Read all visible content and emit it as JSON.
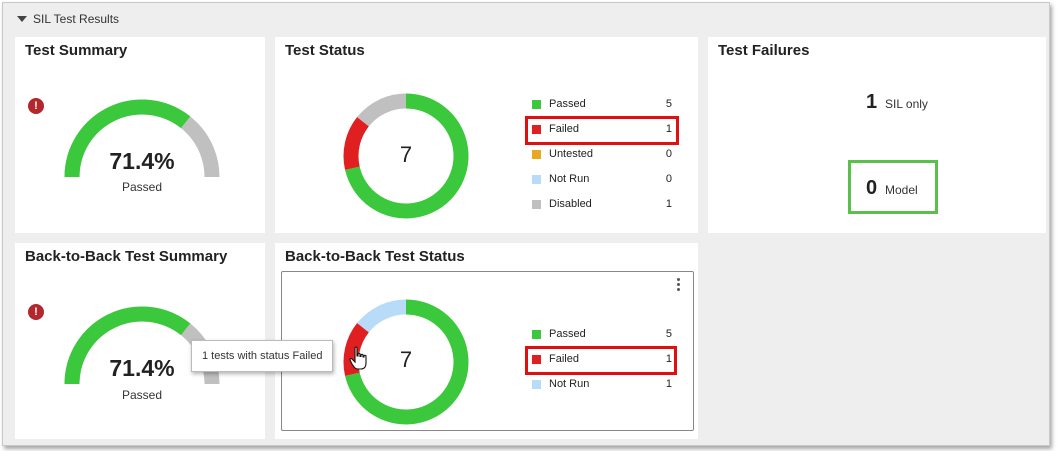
{
  "section": {
    "title": "SIL Test Results"
  },
  "colors": {
    "passed": "#3cc83c",
    "failed": "#e02020",
    "untested": "#e8a820",
    "not_run": "#b8dcf8",
    "disabled": "#c0c0c0",
    "warn": "#b3282d",
    "highlight_red": "#e01010",
    "highlight_green": "#5bbf4b"
  },
  "test_summary": {
    "title": "Test Summary",
    "value": "71.4%",
    "label": "Passed",
    "fraction": 0.714
  },
  "test_status": {
    "title": "Test Status",
    "total": "7",
    "items": [
      {
        "label": "Passed",
        "count": "5",
        "value": 5,
        "color": "#3cc83c"
      },
      {
        "label": "Failed",
        "count": "1",
        "value": 1,
        "color": "#e02020"
      },
      {
        "label": "Untested",
        "count": "0",
        "value": 0,
        "color": "#e8a820"
      },
      {
        "label": "Not Run",
        "count": "0",
        "value": 0,
        "color": "#b8dcf8"
      },
      {
        "label": "Disabled",
        "count": "1",
        "value": 1,
        "color": "#c0c0c0"
      }
    ]
  },
  "test_failures": {
    "title": "Test Failures",
    "sil_count": "1",
    "sil_label": "SIL only",
    "model_count": "0",
    "model_label": "Model"
  },
  "b2b_summary": {
    "title": "Back-to-Back Test Summary",
    "value": "71.4%",
    "label": "Passed",
    "fraction": 0.714
  },
  "b2b_status": {
    "title": "Back-to-Back Test Status",
    "total": "7",
    "items": [
      {
        "label": "Passed",
        "count": "5",
        "value": 5,
        "color": "#3cc83c"
      },
      {
        "label": "Failed",
        "count": "1",
        "value": 1,
        "color": "#e02020"
      },
      {
        "label": "Not Run",
        "count": "1",
        "value": 1,
        "color": "#b8dcf8"
      }
    ],
    "tooltip": "1 tests with status Failed"
  }
}
